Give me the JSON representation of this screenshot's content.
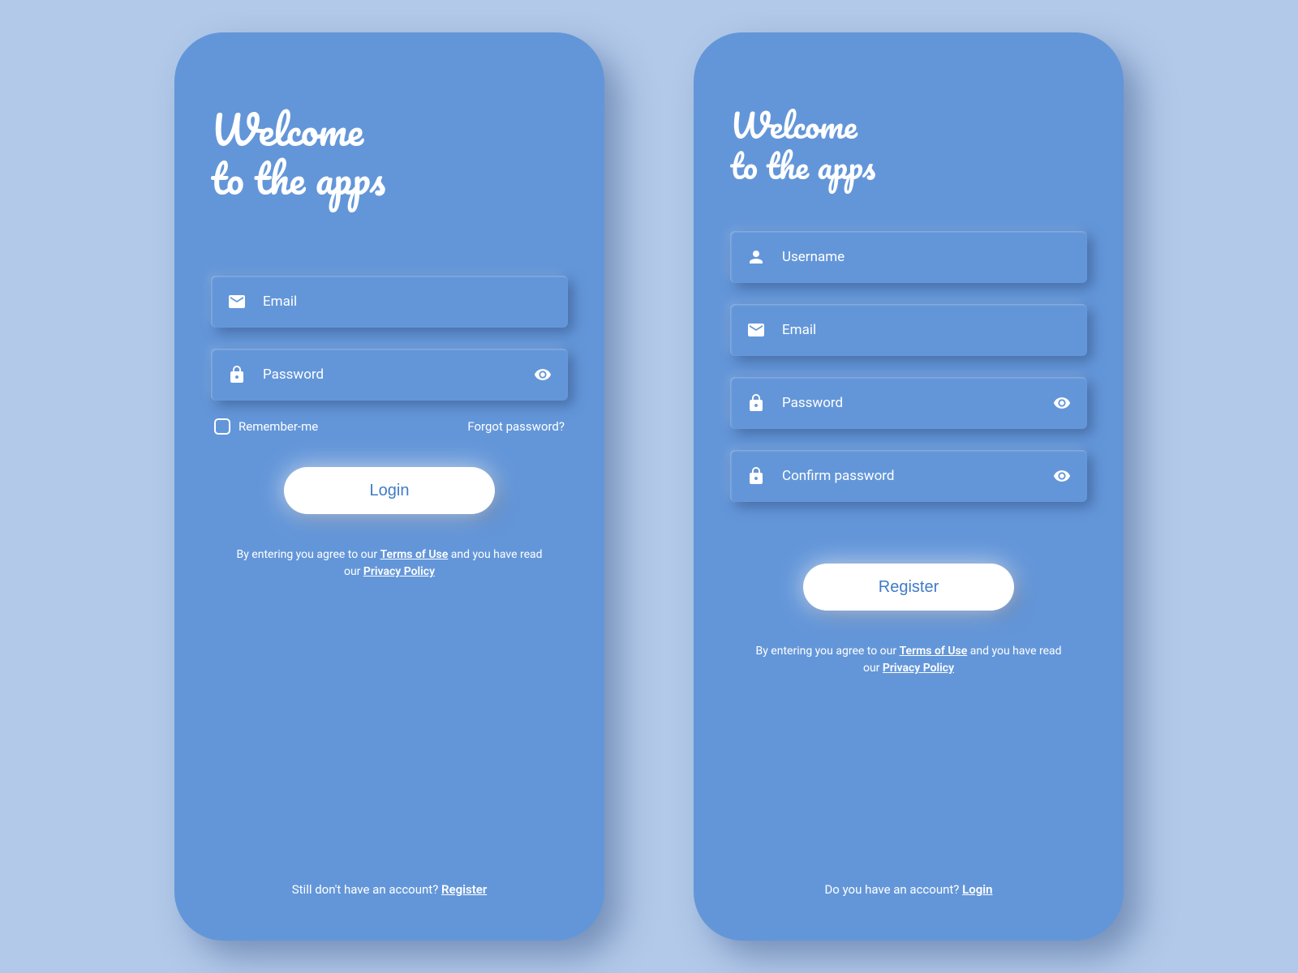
{
  "login": {
    "title_line1": "Welcome",
    "title_line2": "to the apps",
    "email_placeholder": "Email",
    "password_placeholder": "Password",
    "remember_label": "Remember-me",
    "forgot_label": "Forgot password?",
    "button_label": "Login",
    "legal_prefix": "By entering you agree to our ",
    "terms_label": "Terms of Use",
    "legal_mid": " and you have read our ",
    "privacy_label": "Privacy Policy",
    "footer_prefix": "Still don't have an account? ",
    "footer_link": "Register"
  },
  "register": {
    "title_line1": "Welcome",
    "title_line2": "to the apps",
    "username_placeholder": "Username",
    "email_placeholder": "Email",
    "password_placeholder": "Password",
    "confirm_placeholder": "Confirm password",
    "button_label": "Register",
    "legal_prefix": "By entering you agree to our ",
    "terms_label": "Terms of Use",
    "legal_mid": " and you have read our ",
    "privacy_label": "Privacy Policy",
    "footer_prefix": "Do you have an account? ",
    "footer_link": "Login"
  }
}
